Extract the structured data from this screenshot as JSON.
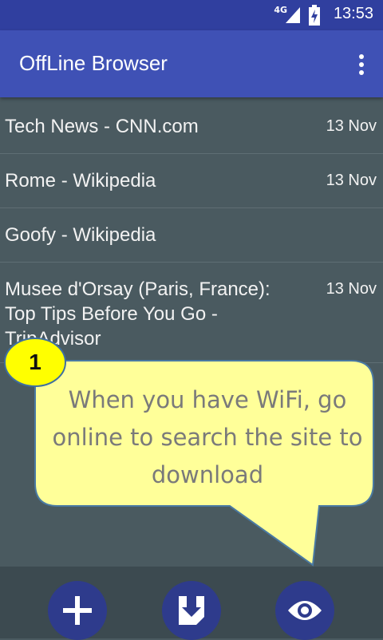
{
  "status_bar": {
    "network": "4G",
    "time": "13:53"
  },
  "app_bar": {
    "title": "OffLine Browser",
    "overflow_icon": "more-vert-icon"
  },
  "pages": [
    {
      "title": "Tech News - CNN.com",
      "date": "13 Nov"
    },
    {
      "title": "Rome - Wikipedia",
      "date": "13 Nov"
    },
    {
      "title": "Goofy - Wikipedia",
      "date": ""
    },
    {
      "title": "Musee d'Orsay (Paris, France): Top Tips Before You Go - TripAdvisor",
      "date": "13 Nov"
    }
  ],
  "tooltip": {
    "step": "1",
    "text": "When you have WiFi, go online to search the site to download",
    "bubble_color": "#ffff99",
    "badge_color": "#ffff00"
  },
  "bottom_bar": {
    "buttons": [
      {
        "name": "add-button",
        "icon": "plus-icon"
      },
      {
        "name": "download-button",
        "icon": "download-icon"
      },
      {
        "name": "view-button",
        "icon": "eye-icon"
      }
    ]
  },
  "colors": {
    "primary": "#3f51b5",
    "primary_dark": "#303f9f",
    "background": "#4a5a60",
    "fab": "#2e3b8c"
  }
}
